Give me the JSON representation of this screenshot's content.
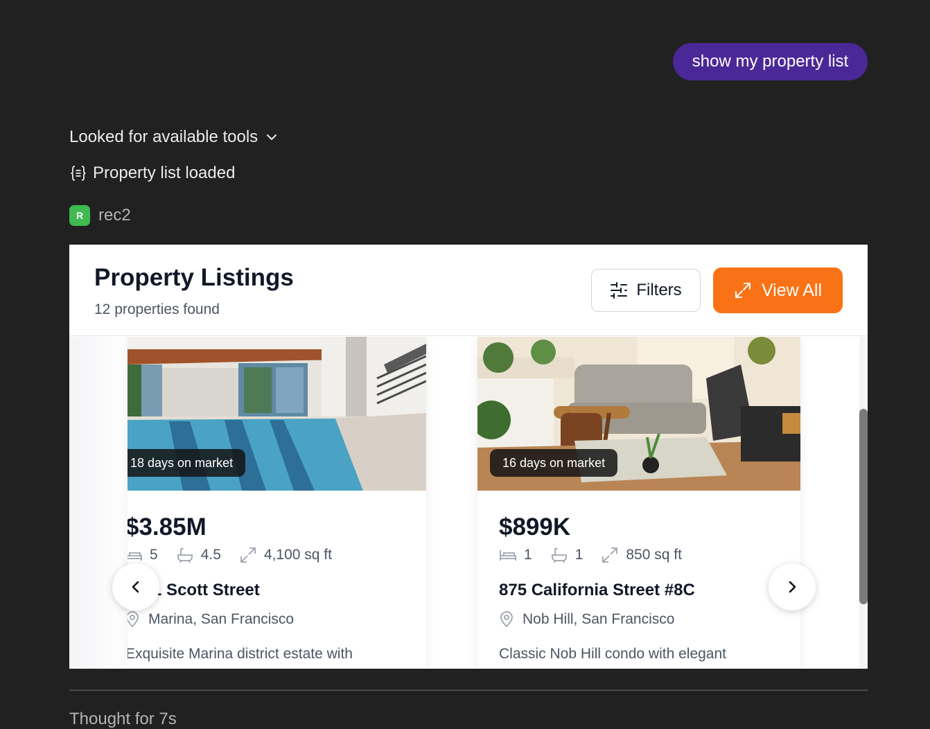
{
  "chat": {
    "user_message": "show my property list",
    "tools_label": "Looked for available tools",
    "status_label": "Property list loaded",
    "app_initial": "R",
    "app_name": "rec2",
    "thought_label": "Thought for 7s"
  },
  "widget": {
    "title": "Property Listings",
    "subtitle": "12 properties found",
    "filters_label": "Filters",
    "view_all_label": "View All",
    "accent_color": "#f97316"
  },
  "listings": [
    {
      "days_on_market": "18 days on market",
      "price": "$3.85M",
      "beds": "5",
      "baths": "4.5",
      "sqft": "4,100 sq ft",
      "address": "3241 Scott Street",
      "location": "Marina, San Francisco",
      "description": "Exquisite Marina district estate with"
    },
    {
      "days_on_market": "16 days on market",
      "price": "$899K",
      "beds": "1",
      "baths": "1",
      "sqft": "850 sq ft",
      "address": "875 California Street #8C",
      "location": "Nob Hill, San Francisco",
      "description": "Classic Nob Hill condo with elegant"
    }
  ],
  "icons": {
    "chevron": "chevron-down-icon",
    "json": "json-braces-icon",
    "filters": "sliders-icon",
    "expand": "expand-arrows-icon",
    "bed": "bed-icon",
    "bath": "bath-icon",
    "size": "resize-icon",
    "pin": "map-pin-icon",
    "prev": "chevron-left-icon",
    "next": "chevron-right-icon"
  }
}
